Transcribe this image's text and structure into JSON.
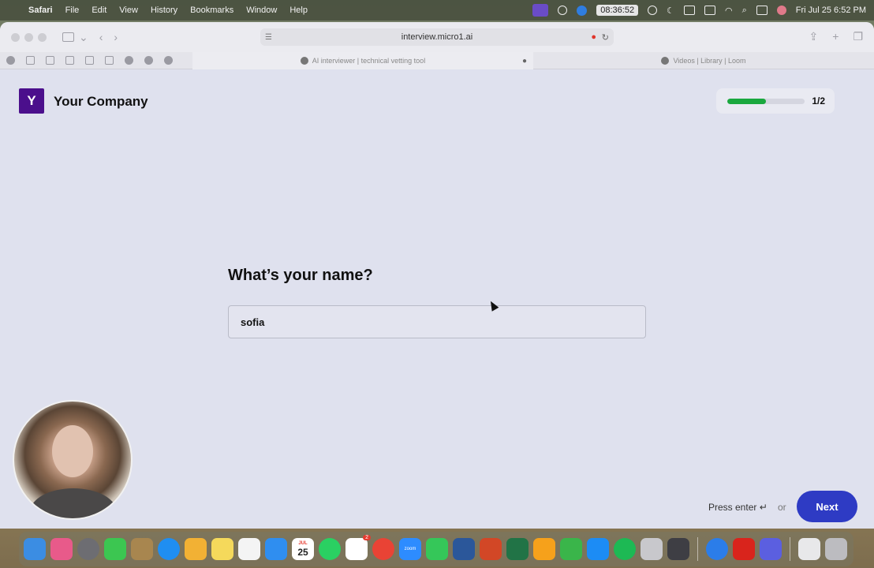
{
  "menubar": {
    "app_name": "Safari",
    "menus": [
      "File",
      "Edit",
      "View",
      "History",
      "Bookmarks",
      "Window",
      "Help"
    ],
    "timer": "08:36:52",
    "datetime": "Fri Jul 25  6:52 PM"
  },
  "browser": {
    "url": "interview.micro1.ai",
    "tabs": [
      {
        "title": "AI interviewer | technical vetting tool",
        "active": true
      },
      {
        "title": "Videos | Library | Loom",
        "active": false
      }
    ]
  },
  "page": {
    "logo_letter": "Y",
    "company_name": "Your Company",
    "progress_text": "1/2",
    "progress_fraction": 0.5,
    "question": "What’s your name?",
    "name_input_value": "sofia",
    "press_enter_text": "Press enter ↵",
    "or_text": "or",
    "next_label": "Next",
    "colors": {
      "brand": "#4b0f8c",
      "progress": "#1aa83e",
      "next_button": "#2e3bc4"
    }
  },
  "dock": {
    "calendar_month": "JUL",
    "calendar_day": "25",
    "zoom_label": "zoom",
    "slack_badge": "2"
  }
}
